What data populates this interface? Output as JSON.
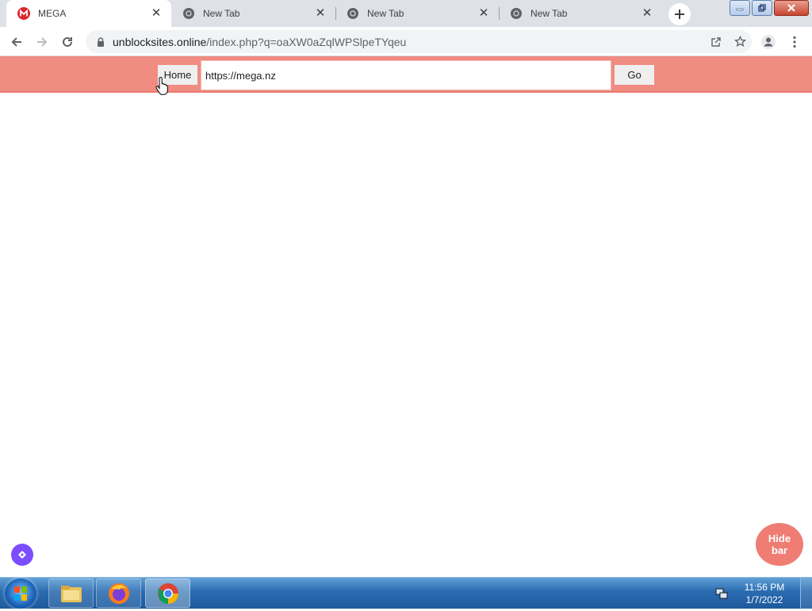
{
  "browser": {
    "tabs": [
      {
        "title": "MEGA",
        "favicon": "mega-icon",
        "active": true
      },
      {
        "title": "New Tab",
        "favicon": "chrome-icon",
        "active": false
      },
      {
        "title": "New Tab",
        "favicon": "chrome-icon",
        "active": false
      },
      {
        "title": "New Tab",
        "favicon": "chrome-icon",
        "active": false
      }
    ],
    "url_host": "unblocksites.online",
    "url_path": "/index.php?q=oaXW0aZqlWPSlpeTYqeu"
  },
  "proxy_bar": {
    "home_label": "Home",
    "address_value": "https://mega.nz",
    "go_label": "Go",
    "background": "#f08c82"
  },
  "floating": {
    "hide_bar_line1": "Hide",
    "hide_bar_line2": "bar"
  },
  "taskbar": {
    "apps": [
      "file-explorer-icon",
      "firefox-icon",
      "chrome-icon"
    ],
    "time": "11:56 PM",
    "date": "1/7/2022"
  }
}
